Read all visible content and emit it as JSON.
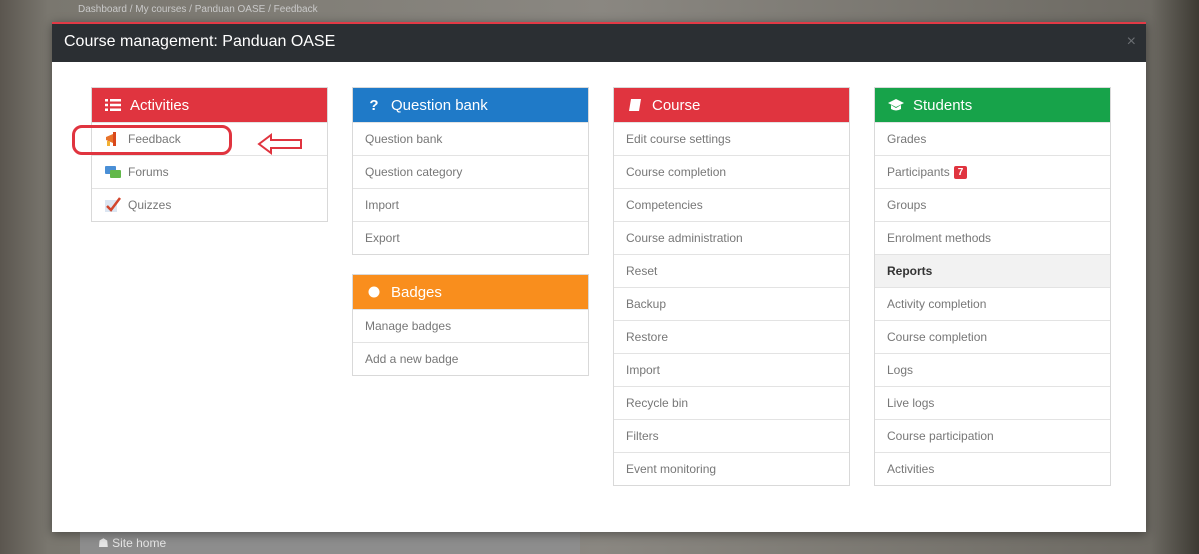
{
  "backdrop": {
    "breadcrumb": "Dashboard / My courses / Panduan OASE / Feedback",
    "site_home": "Site home"
  },
  "modal": {
    "title": "Course management: Panduan OASE",
    "close": "×"
  },
  "activities": {
    "title": "Activities",
    "items": [
      {
        "label": "Feedback",
        "icon": "megaphone-icon"
      },
      {
        "label": "Forums",
        "icon": "forum-icon"
      },
      {
        "label": "Quizzes",
        "icon": "quiz-check-icon"
      }
    ]
  },
  "question_bank": {
    "title": "Question bank",
    "items": [
      "Question bank",
      "Question category",
      "Import",
      "Export"
    ]
  },
  "badges": {
    "title": "Badges",
    "items": [
      "Manage badges",
      "Add a new badge"
    ]
  },
  "course": {
    "title": "Course",
    "items": [
      "Edit course settings",
      "Course completion",
      "Competencies",
      "Course administration",
      "Reset",
      "Backup",
      "Restore",
      "Import",
      "Recycle bin",
      "Filters",
      "Event monitoring"
    ]
  },
  "students": {
    "title": "Students",
    "items_top": [
      "Grades",
      "Participants",
      "Groups",
      "Enrolment methods"
    ],
    "participants_badge": "7",
    "reports_header": "Reports",
    "items_reports": [
      "Activity completion",
      "Course completion",
      "Logs",
      "Live logs",
      "Course participation",
      "Activities"
    ]
  },
  "colors": {
    "header_bg": "#2b2f33",
    "activities": "#e0343f",
    "question_bank": "#1f7ac8",
    "badges": "#f98e1d",
    "course": "#e0343f",
    "students": "#17a34a",
    "annotation": "#e0343f"
  }
}
